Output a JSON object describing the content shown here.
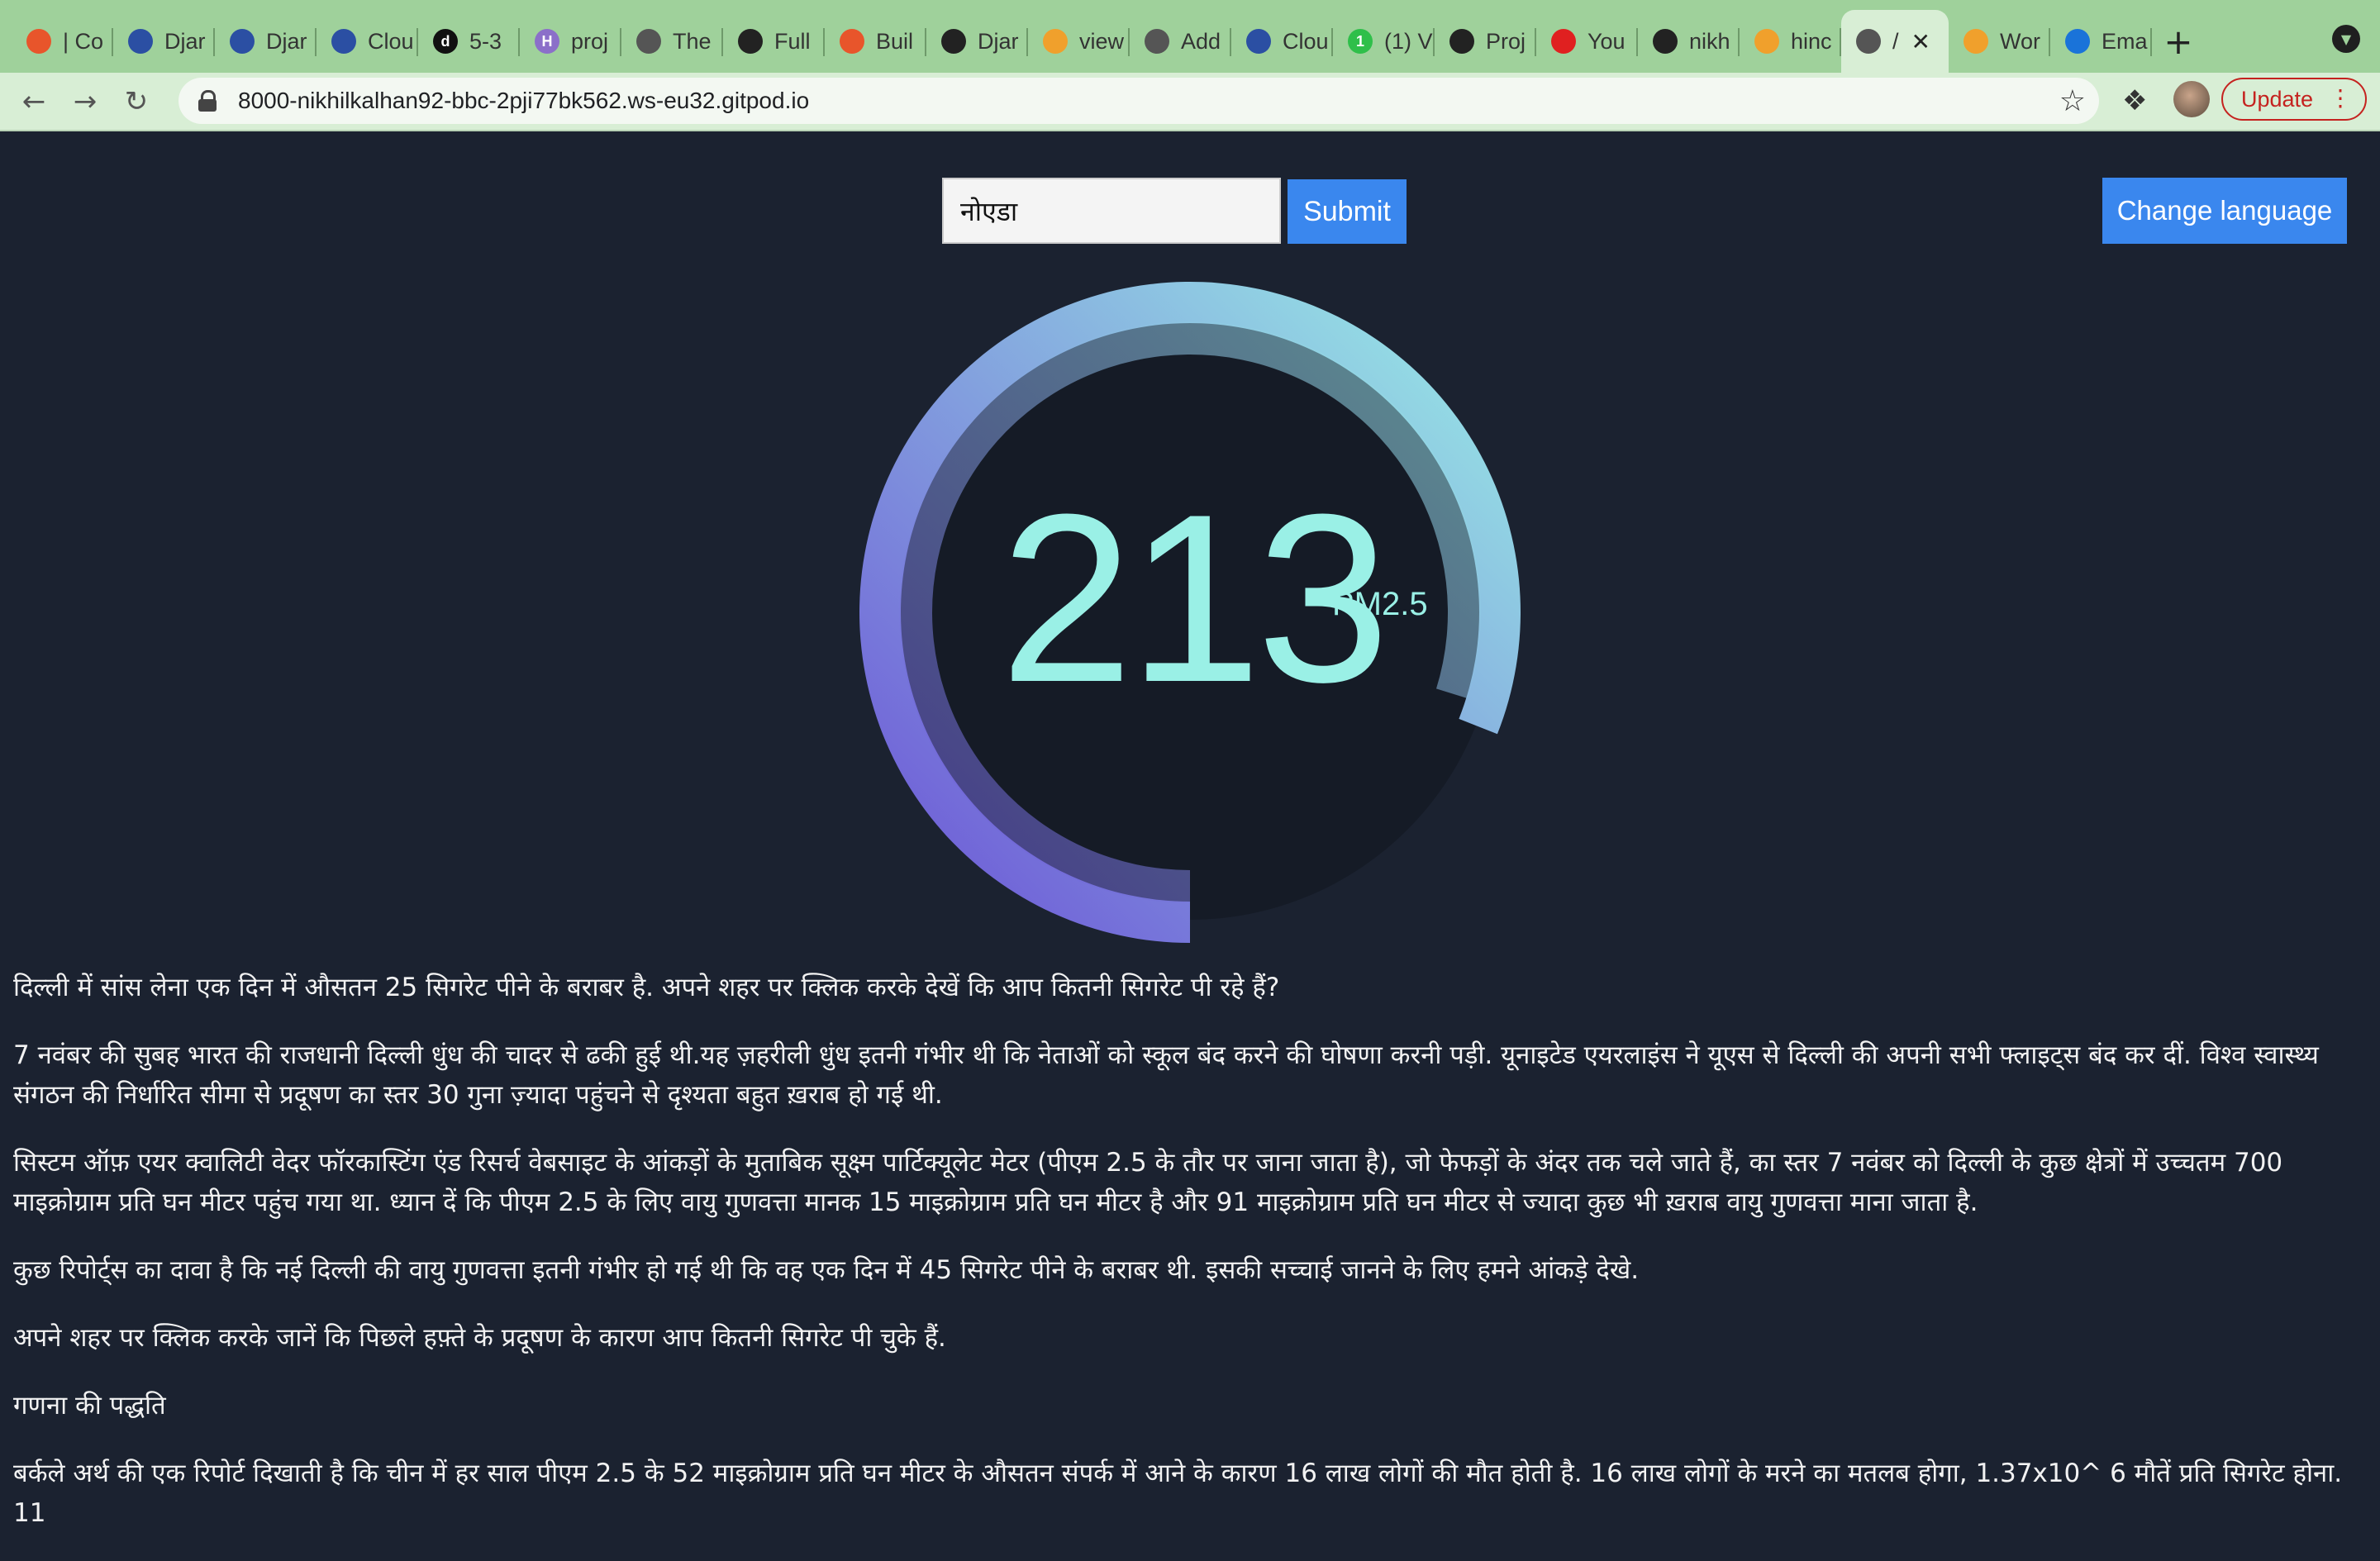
{
  "browser": {
    "tabs": [
      {
        "label": "| Co",
        "icon": "circle-icon",
        "color": "#e8552b"
      },
      {
        "label": "Djar",
        "icon": "college-logo-icon",
        "color": "#2b4fa3"
      },
      {
        "label": "Djar",
        "icon": "college-logo-icon",
        "color": "#2b4fa3"
      },
      {
        "label": "Clou",
        "icon": "cloud-icon",
        "color": "#2b4fa3"
      },
      {
        "label": "5-3",
        "icon": "d-letter-icon",
        "color": "#111111",
        "glyph": "d"
      },
      {
        "label": "proj",
        "icon": "h-letter-icon",
        "color": "#8b6fc9",
        "glyph": "H"
      },
      {
        "label": "The",
        "icon": "globe-icon",
        "color": "#555555"
      },
      {
        "label": "Full",
        "icon": "github-icon",
        "color": "#222222"
      },
      {
        "label": "Buil",
        "icon": "circle-icon",
        "color": "#e8552b"
      },
      {
        "label": "Djar",
        "icon": "github-icon",
        "color": "#222222"
      },
      {
        "label": "view",
        "icon": "swirl-icon",
        "color": "#f0a02c"
      },
      {
        "label": "Add",
        "icon": "globe-icon",
        "color": "#555555"
      },
      {
        "label": "Clou",
        "icon": "cloud-icon",
        "color": "#2b4fa3"
      },
      {
        "label": "(1) V",
        "icon": "whatsapp-icon",
        "color": "#2fbf4a",
        "glyph": "1"
      },
      {
        "label": "Proj",
        "icon": "github-icon",
        "color": "#222222"
      },
      {
        "label": "You",
        "icon": "youtube-icon",
        "color": "#e02020"
      },
      {
        "label": "nikh",
        "icon": "github-icon",
        "color": "#222222"
      },
      {
        "label": "hinc",
        "icon": "swirl-icon",
        "color": "#f0a02c"
      },
      {
        "label": "/",
        "icon": "globe-icon",
        "color": "#555555",
        "active": true
      },
      {
        "label": "Wor",
        "icon": "swirl-icon",
        "color": "#f0a02c"
      },
      {
        "label": "Ema",
        "icon": "outlook-icon",
        "color": "#1a73d9"
      }
    ],
    "url": "8000-nikhilkalhan92-bbc-2pji77bk562.ws-eu32.gitpod.io",
    "update_label": "Update"
  },
  "form": {
    "city_value": "नोएडा",
    "submit_label": "Submit"
  },
  "change_language_label": "Change language",
  "gauge": {
    "value": "213",
    "unit": "PM2.5",
    "fill_fraction": 0.81,
    "color_start": "#6b4fd6",
    "color_end": "#9af0e6"
  },
  "article": {
    "paragraphs": [
      "दिल्ली में सांस लेना एक दिन में औसतन 25 सिगरेट पीने के बराबर है. अपने शहर पर क्लिक करके देखें कि आप कितनी सिगरेट पी रहे हैं?",
      "7 नवंबर की सुबह भारत की राजधानी दिल्ली धुंध की चादर से ढकी हुई थी.यह ज़हरीली धुंध इतनी गंभीर थी कि नेताओं को स्कूल बंद करने की घोषणा करनी पड़ी. यूनाइटेड एयरलाइंस ने यूएस से दिल्ली की अपनी सभी फ्लाइट्स बंद कर दीं. विश्व स्वास्थ्य संगठन की निर्धारित सीमा से प्रदूषण का स्तर 30 गुना ज़्यादा पहुंचने से दृश्यता बहुत ख़राब हो गई थी.",
      "सिस्टम ऑफ़ एयर क्वालिटी वेदर फॉरकास्टिंग एंड रिसर्च वेबसाइट के आंकड़ों के मुताबिक सूक्ष्म पार्टिक्यूलेट मेटर (पीएम 2.5 के तौर पर जाना जाता है), जो फेफड़ों के अंदर तक चले जाते हैं, का स्तर 7 नवंबर को दिल्ली के कुछ क्षेत्रों में उच्चतम 700 माइक्रोग्राम प्रति घन मीटर पहुंच गया था. ध्यान दें कि पीएम 2.5 के लिए वायु गुणवत्ता मानक 15 माइक्रोग्राम प्रति घन मीटर है और 91 माइक्रोग्राम प्रति घन मीटर से ज्यादा कुछ भी ख़राब वायु गुणवत्ता माना जाता है.",
      "कुछ रिपोर्ट्स का दावा है कि नई दिल्ली की वायु गुणवत्ता इतनी गंभीर हो गई थी कि वह एक दिन में 45 सिगरेट पीने के बराबर थी. इसकी सच्चाई जानने के लिए हमने आंकड़े देखे.",
      "अपने शहर पर क्लिक करके जानें कि पिछले हफ़्ते के प्रदूषण के कारण आप कितनी सिगरेट पी चुके हैं.",
      "गणना की पद्धति",
      "बर्कले अर्थ की एक रिपोर्ट दिखाती है कि चीन में हर साल पीएम 2.5 के 52 माइक्रोग्राम प्रति घन मीटर के औसतन संपर्क में आने के कारण 16 लाख लोगों की मौत होती है. 16 लाख लोगों के मरने का मतलब होगा, 1.37x10^ 6 मौतें प्रति सिगरेट होना. 11"
    ]
  }
}
